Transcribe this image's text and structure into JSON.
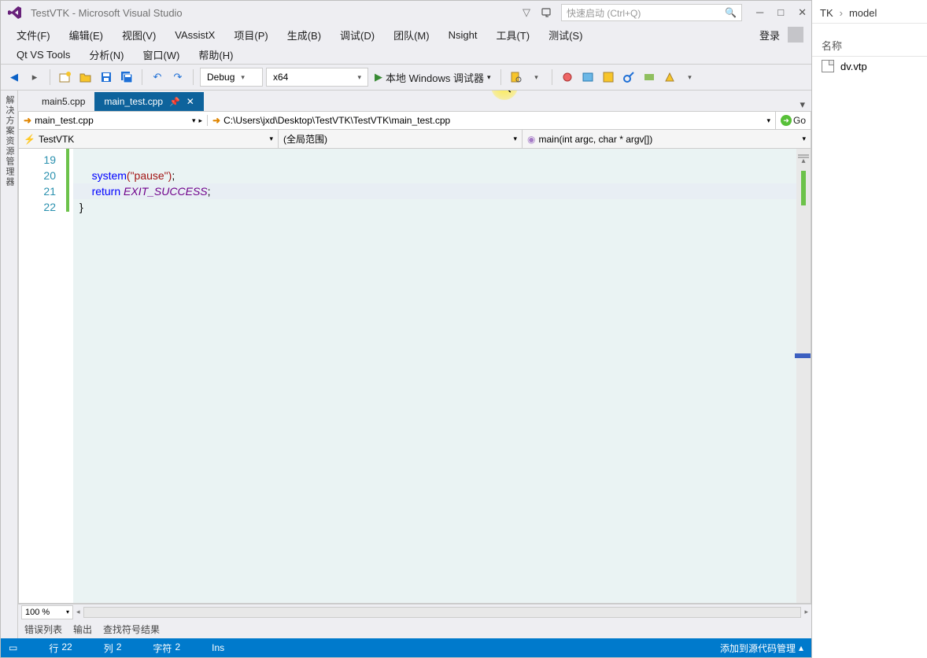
{
  "titlebar": {
    "title": "TestVTK - Microsoft Visual Studio",
    "quick_launch_placeholder": "快速启动 (Ctrl+Q)"
  },
  "menu": {
    "file": "文件(F)",
    "edit": "编辑(E)",
    "view": "视图(V)",
    "vassist": "VAssistX",
    "project": "项目(P)",
    "build": "生成(B)",
    "debug": "调试(D)",
    "team": "团队(M)",
    "nsight": "Nsight",
    "tools": "工具(T)",
    "test": "测试(S)",
    "qt": "Qt VS Tools",
    "analyze": "分析(N)",
    "window": "窗口(W)",
    "help": "帮助(H)",
    "login": "登录"
  },
  "toolbar": {
    "config": "Debug",
    "platform": "x64",
    "debugger": "本地 Windows 调试器"
  },
  "tabs": {
    "inactive": "main5.cpp",
    "active": "main_test.cpp"
  },
  "nav": {
    "file": "main_test.cpp",
    "path": "C:\\Users\\jxd\\Desktop\\TestVTK\\TestVTK\\main_test.cpp",
    "go": "Go"
  },
  "scope": {
    "project": "TestVTK",
    "scope": "(全局范围)",
    "func": "main(int argc, char * argv[])"
  },
  "code": {
    "lines": [
      "19",
      "20",
      "21",
      "22"
    ],
    "l20_kw": "system",
    "l20_str": "(\"pause\")",
    "l20_end": ";",
    "l21_kw": "return",
    "l21_em": "EXIT_SUCCESS",
    "l21_end": ";",
    "l22": "}"
  },
  "zoom": "100 %",
  "bottom_tabs": {
    "errors": "错误列表",
    "output": "输出",
    "find": "查找符号结果"
  },
  "status": {
    "line_label": "行",
    "line": "22",
    "col_label": "列",
    "col": "2",
    "char_label": "字符",
    "char": "2",
    "ins": "Ins",
    "scm": "添加到源代码管理"
  },
  "side_panel": "解决方案资源管理器",
  "right": {
    "bc1": "TK",
    "bc2": "model",
    "col": "名称",
    "file": "dv.vtp"
  }
}
